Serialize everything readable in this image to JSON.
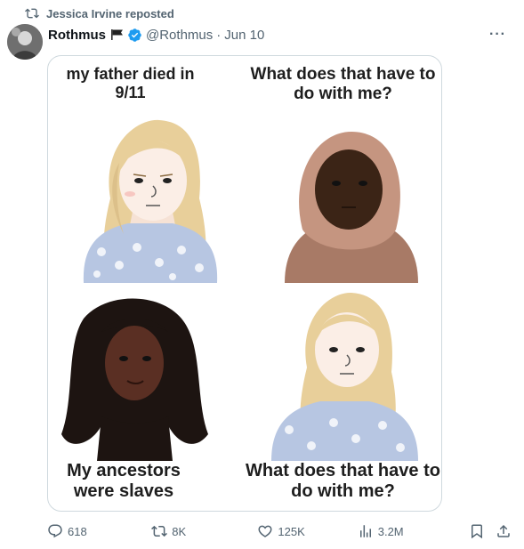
{
  "repost": {
    "label": "Jessica Irvine reposted",
    "icon": "repost-icon"
  },
  "post": {
    "author_name": "Rothmus",
    "handle": "@Rothmus",
    "separator": "·",
    "date": "Jun 10",
    "more_label": "···",
    "verified_color": "#1d9bf0",
    "media": {
      "panel1_caption": "my father died in 9/11",
      "panel2_caption": "What does that have to do with me?",
      "panel3_caption": "My ancestors were slaves",
      "panel4_caption": "What does that have to do with me?"
    }
  },
  "actions": {
    "replies": "618",
    "reposts": "8K",
    "likes": "125K",
    "views": "3.2M"
  }
}
